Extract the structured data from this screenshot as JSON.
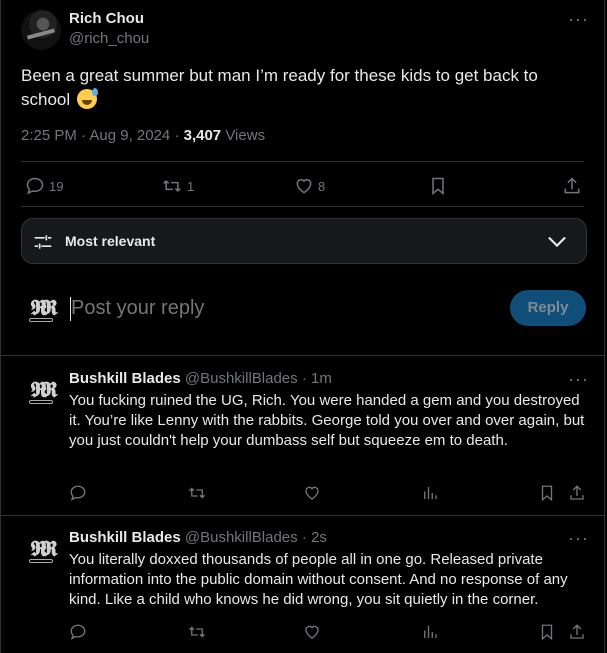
{
  "tweet": {
    "author_name": "Rich Chou",
    "author_handle": "@rich_chou",
    "more_label": "···",
    "text": "Been a great summer but man I’m ready for these kids to get back to school",
    "emoji": "sweat-smile",
    "timestamp": "2:25 PM · Aug 9, 2024 · ",
    "views_count": "3,407",
    "views_label": " Views",
    "actions": {
      "replies": "19",
      "reposts": "1",
      "likes": "8"
    }
  },
  "sort": {
    "label": "Most relevant"
  },
  "compose": {
    "placeholder": "Post your reply",
    "reply_button": "Reply"
  },
  "replies": [
    {
      "name": "Bushkill Blades",
      "handle": "@BushkillBlades",
      "time": "· 1m",
      "text": "You fucking ruined the UG, Rich. You were handed a gem and you destroyed it. You’re like Lenny with the rabbits. George told you over and over again, but you just couldn't help your dumbass self but squeeze em to death."
    },
    {
      "name": "Bushkill Blades",
      "handle": "@BushkillBlades",
      "time": "· 2s",
      "text": "You literally doxxed thousands of people all in one go. Released private information into the public domain without consent. And no response of any kind. Like a child who knows he did wrong, you sit quietly in the corner."
    }
  ],
  "colors": {
    "background": "#000000",
    "text": "#e7e9ea",
    "muted": "#71767b",
    "border": "#2f3336",
    "reply_button_bg": "#0f4e78"
  }
}
